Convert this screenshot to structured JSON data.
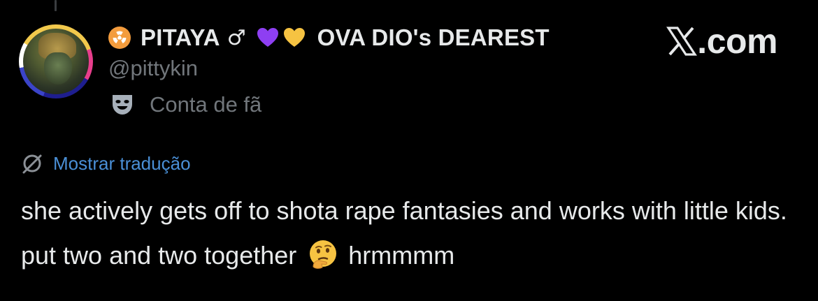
{
  "author": {
    "display_name_part1": "PITAYA",
    "male_symbol": "♂",
    "display_name_part2": "OVA DIO's DEAREST",
    "handle": "@pittykin",
    "account_label": "Conta de fã"
  },
  "brand": {
    "label": ".com"
  },
  "tweet": {
    "translate_link": "Mostrar tradução",
    "text_part1": "she actively gets off to shota rape fantasies and works with little kids. put two and two together",
    "text_part2": "hrmmmm"
  },
  "icons": {
    "radioactive": "radioactive-icon",
    "purple_heart": "purple-heart-icon",
    "yellow_heart": "yellow-heart-icon",
    "x_logo": "x-logo-icon",
    "mask": "theater-mask-icon",
    "translate": "translate-globe-icon",
    "thinking": "thinking-face-icon"
  },
  "colors": {
    "background": "#000000",
    "text": "#e7e9ea",
    "secondary": "#71767b",
    "link": "#4a8fd6",
    "radioactive_bg": "#f39c3d",
    "purple_heart": "#8e3ff2",
    "yellow_heart": "#f6c342"
  }
}
